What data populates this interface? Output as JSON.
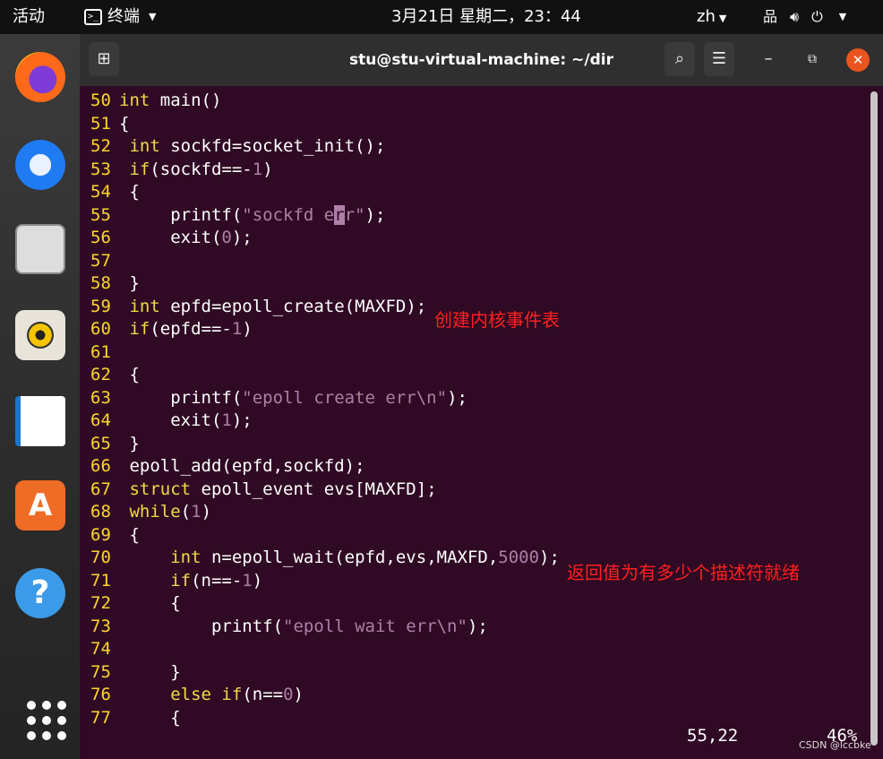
{
  "topbar": {
    "activities": "活动",
    "terminal_menu": "终端",
    "datetime": "3月21日 星期二，23：44",
    "lang": "zh"
  },
  "dock": {
    "items": [
      "firefox-icon",
      "thunderbird-icon",
      "files-icon",
      "rhythmbox-icon",
      "libreoffice-writer-icon",
      "app-store-icon",
      "help-icon",
      "show-apps-icon"
    ]
  },
  "window": {
    "title": "stu@stu-virtual-machine: ~/dir"
  },
  "code_lines": [
    {
      "n": "50",
      "t": "int main()"
    },
    {
      "n": "51",
      "t": "{"
    },
    {
      "n": "52",
      "t": " int sockfd=socket_init();"
    },
    {
      "n": "53",
      "t": " if(sockfd==-1)"
    },
    {
      "n": "54",
      "t": " {"
    },
    {
      "n": "55",
      "t": "     printf(\"sockfd err\");"
    },
    {
      "n": "56",
      "t": "     exit(0);"
    },
    {
      "n": "57",
      "t": ""
    },
    {
      "n": "58",
      "t": " }"
    },
    {
      "n": "59",
      "t": " int epfd=epoll_create(MAXFD);"
    },
    {
      "n": "60",
      "t": " if(epfd==-1)"
    },
    {
      "n": "61",
      "t": ""
    },
    {
      "n": "62",
      "t": " {"
    },
    {
      "n": "63",
      "t": "     printf(\"epoll create err\\n\");"
    },
    {
      "n": "64",
      "t": "     exit(1);"
    },
    {
      "n": "65",
      "t": " }"
    },
    {
      "n": "66",
      "t": " epoll_add(epfd,sockfd);"
    },
    {
      "n": "67",
      "t": " struct epoll_event evs[MAXFD];"
    },
    {
      "n": "68",
      "t": " while(1)"
    },
    {
      "n": "69",
      "t": " {"
    },
    {
      "n": "70",
      "t": "     int n=epoll_wait(epfd,evs,MAXFD,5000);"
    },
    {
      "n": "71",
      "t": "     if(n==-1)"
    },
    {
      "n": "72",
      "t": "     {"
    },
    {
      "n": "73",
      "t": "         printf(\"epoll wait err\\n\");"
    },
    {
      "n": "74",
      "t": ""
    },
    {
      "n": "75",
      "t": "     }"
    },
    {
      "n": "76",
      "t": "     else if(n==0)"
    },
    {
      "n": "77",
      "t": "     {"
    }
  ],
  "annotations": {
    "a1": "创建内核事件表",
    "a2": "返回值为有多少个描述符就绪"
  },
  "status": {
    "position": "55,22",
    "percent": "46%"
  },
  "watermark": "CSDN @lccbke",
  "colors": {
    "terminal_bg": "#300a24",
    "line_number": "#fcd62d",
    "keyword": "#f2d94a",
    "string": "#ad7fa8",
    "annotation": "#ff1f1f"
  }
}
